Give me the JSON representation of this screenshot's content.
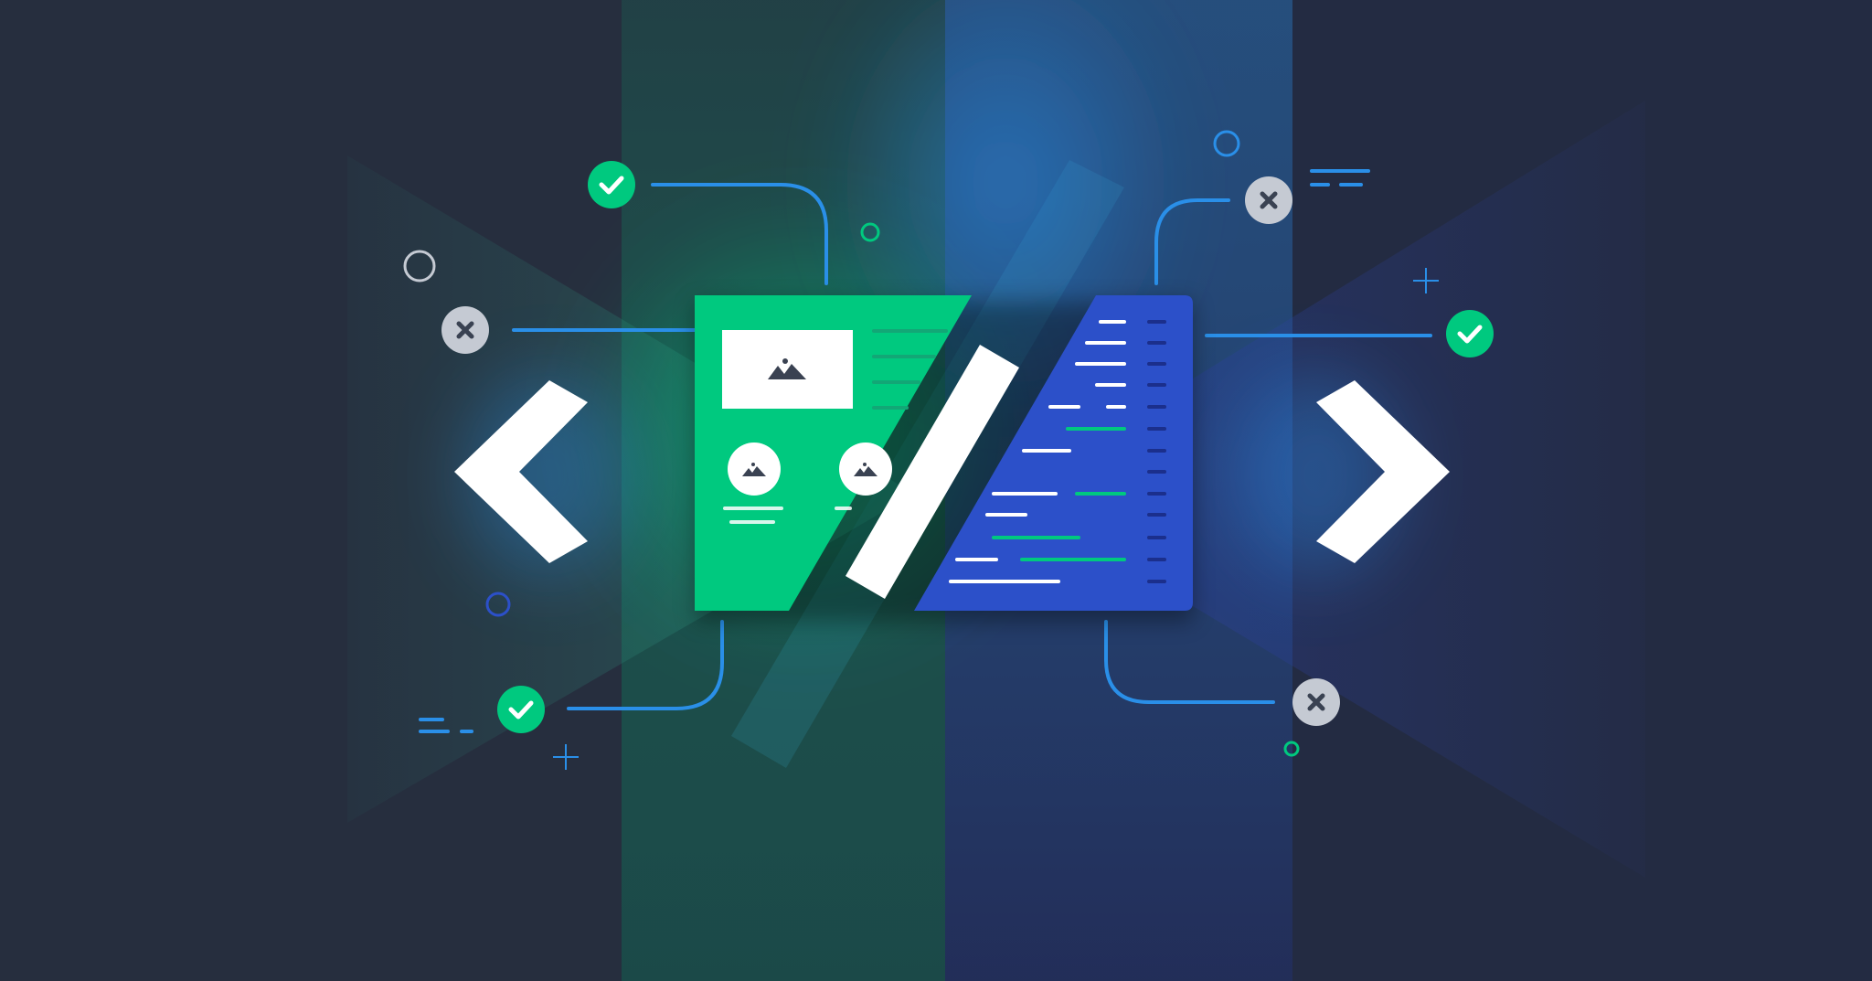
{
  "colors": {
    "background": "#262e3e",
    "green": "#00c97f",
    "blue": "#2c50c9",
    "accent_blue": "#2a8fe8",
    "white": "#ffffff",
    "gray_badge": "#c5cad3",
    "icon_dark": "#3a4252"
  },
  "icons": {
    "left_bracket": "chevron-left-icon",
    "right_bracket": "chevron-right-icon",
    "check": "check-circle-icon",
    "cross": "x-circle-icon",
    "image": "image-icon"
  }
}
